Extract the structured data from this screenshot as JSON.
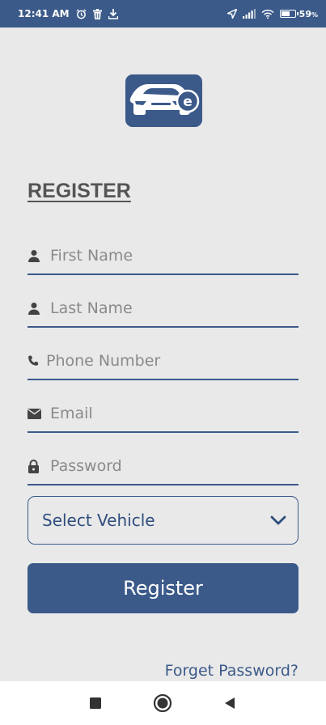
{
  "status_bar": {
    "time": "12:41 AM",
    "battery_percent": "59",
    "battery_suffix": "%",
    "left_icons": [
      "alarm-icon",
      "trash-icon",
      "download-icon"
    ],
    "right_icons": [
      "location-arrow-icon",
      "signal-icon",
      "wifi-icon",
      "battery-icon"
    ]
  },
  "logo": {
    "icon": "car-e-logo-icon"
  },
  "page_title": "REGISTER",
  "form": {
    "first_name": {
      "placeholder": "First Name",
      "value": "",
      "icon": "person-icon"
    },
    "last_name": {
      "placeholder": "Last Name",
      "value": "",
      "icon": "person-icon"
    },
    "phone": {
      "placeholder": "Phone Number",
      "value": "",
      "icon": "phone-icon"
    },
    "email": {
      "placeholder": "Email",
      "value": "",
      "icon": "envelope-icon"
    },
    "password": {
      "placeholder": "Password",
      "value": "",
      "icon": "lock-icon"
    },
    "vehicle_select": {
      "selected": "Select Vehicle",
      "icon": "chevron-down-icon"
    }
  },
  "register_label": "Register",
  "forget_password_label": "Forget Password?",
  "nav_bar": {
    "icons": [
      "square-recent-icon",
      "circle-home-icon",
      "triangle-back-icon"
    ]
  },
  "colors": {
    "primary": "#3b5a8a",
    "background": "#e9e9e9",
    "title": "#555555",
    "placeholder": "#8a8a8a",
    "nav_bar": "#ffffff"
  }
}
